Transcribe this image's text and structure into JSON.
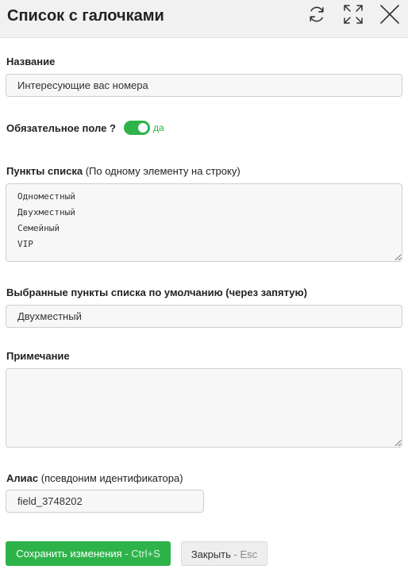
{
  "header": {
    "title": "Список с галочками",
    "icons": [
      "refresh-icon",
      "expand-icon",
      "close-icon"
    ]
  },
  "fields": {
    "name": {
      "label": "Название",
      "value": "Интересующие вас номера"
    },
    "required": {
      "label": "Обязательное поле ?",
      "state": true,
      "state_text": "да"
    },
    "items": {
      "label": "Пункты списка",
      "hint": "(По одному элементу на строку)",
      "value": "Одноместный\nДвухместный\nСемейный\nVIP"
    },
    "defaults": {
      "label": "Выбранные пункты списка по умолчанию (через запятую)",
      "value": "Двухместный"
    },
    "note": {
      "label": "Примечание",
      "value": ""
    },
    "alias": {
      "label": "Алиас",
      "hint": "(псевдоним идентификатора)",
      "value": "field_3748202"
    }
  },
  "buttons": {
    "save": {
      "label": "Сохранить изменения",
      "shortcut": "- Ctrl+S"
    },
    "close": {
      "label": "Закрыть",
      "shortcut": "- Esc"
    }
  },
  "colors": {
    "accent": "#2db34a",
    "header_bg": "#f1f1f1"
  }
}
